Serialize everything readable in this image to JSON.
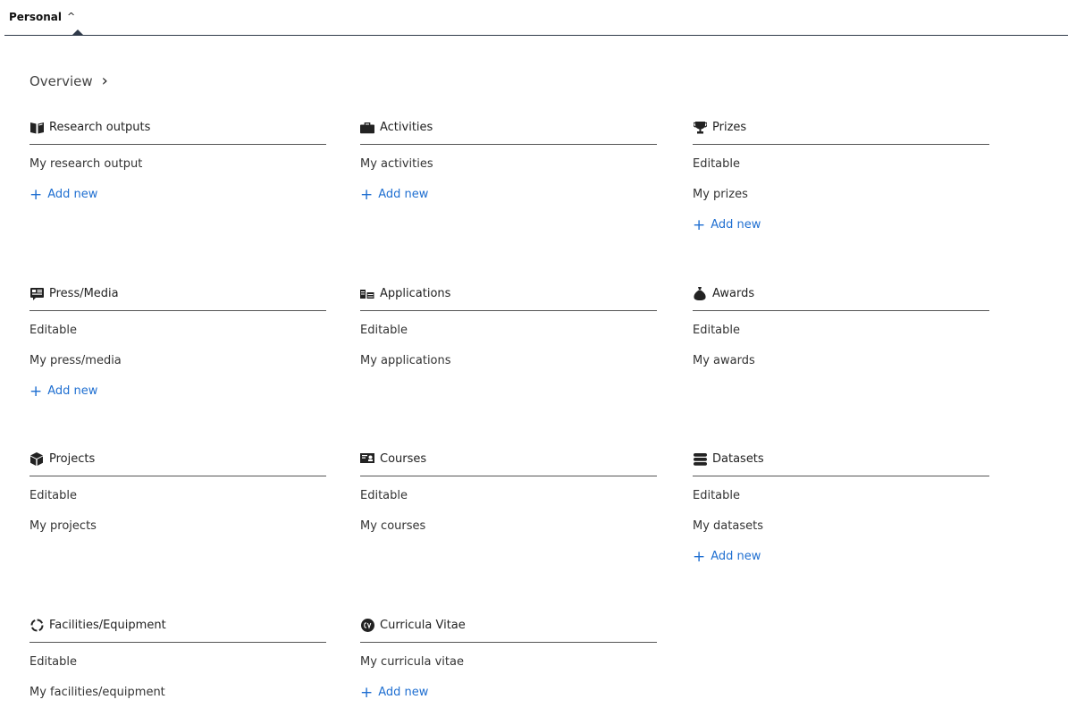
{
  "tab": {
    "label": "Personal"
  },
  "overview": {
    "label": "Overview"
  },
  "sections": {
    "research_outputs": {
      "title": "Research outputs",
      "icon": "book-icon",
      "items": [
        "My research output"
      ],
      "add_new": "Add new"
    },
    "activities": {
      "title": "Activities",
      "icon": "briefcase-icon",
      "items": [
        "My activities"
      ],
      "add_new": "Add new"
    },
    "prizes": {
      "title": "Prizes",
      "icon": "trophy-icon",
      "items": [
        "Editable",
        "My prizes"
      ],
      "add_new": "Add new"
    },
    "press_media": {
      "title": "Press/Media",
      "icon": "newspaper-icon",
      "items": [
        "Editable",
        "My press/media"
      ],
      "add_new": "Add new"
    },
    "applications": {
      "title": "Applications",
      "icon": "applications-icon",
      "items": [
        "Editable",
        "My applications"
      ]
    },
    "awards": {
      "title": "Awards",
      "icon": "money-bag-icon",
      "items": [
        "Editable",
        "My awards"
      ]
    },
    "projects": {
      "title": "Projects",
      "icon": "cube-icon",
      "items": [
        "Editable",
        "My projects"
      ]
    },
    "courses": {
      "title": "Courses",
      "icon": "courses-icon",
      "items": [
        "Editable",
        "My courses"
      ]
    },
    "datasets": {
      "title": "Datasets",
      "icon": "database-icon",
      "items": [
        "Editable",
        "My datasets"
      ],
      "add_new": "Add new"
    },
    "facilities": {
      "title": "Facilities/Equipment",
      "icon": "circle-dashed-icon",
      "items": [
        "Editable",
        "My facilities/equipment"
      ]
    },
    "curricula_vitae": {
      "title": "Curricula Vitae",
      "icon": "cv-icon",
      "items": [
        "My curricula vitae"
      ],
      "add_new": "Add new"
    }
  },
  "colors": {
    "accent": "#1f6fd1",
    "divider": "#555555",
    "tabbar_line": "#2f3a4a"
  }
}
